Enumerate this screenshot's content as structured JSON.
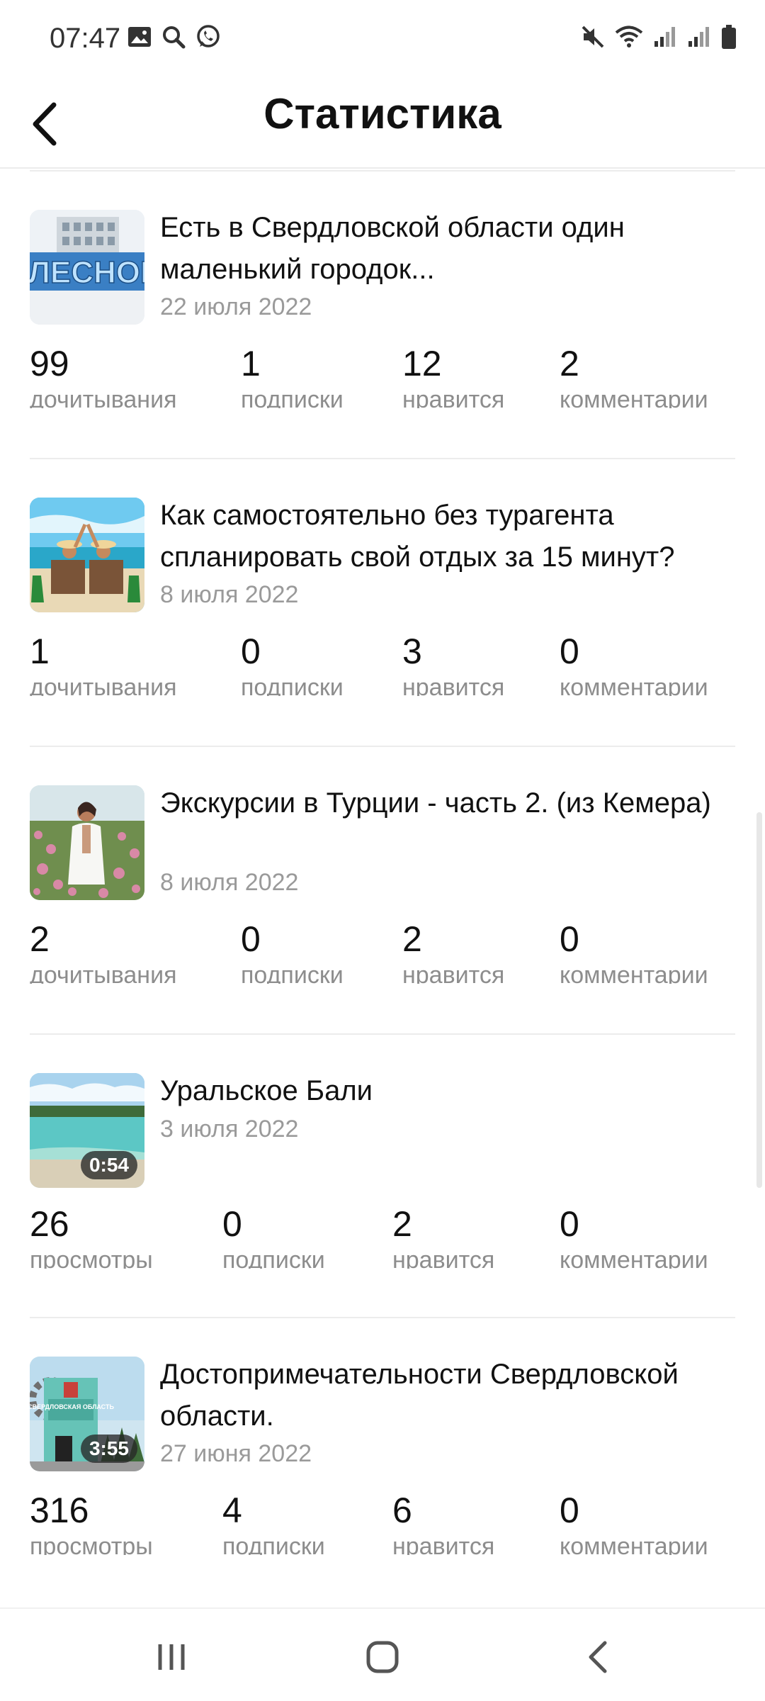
{
  "status_bar": {
    "time": "07:47"
  },
  "header": {
    "title": "Статистика"
  },
  "articles": [
    {
      "title": "Есть в Свердловской области один маленький городок...",
      "date": "22 июля 2022",
      "duration": "",
      "stats": [
        {
          "value": "99",
          "label": "дочитывания"
        },
        {
          "value": "1",
          "label": "подписки"
        },
        {
          "value": "12",
          "label": "нравится"
        },
        {
          "value": "2",
          "label": "комментарии"
        }
      ]
    },
    {
      "title": "Как самостоятельно без турагента спланировать свой отдых за 15 минут?",
      "date": "8 июля 2022",
      "duration": "",
      "stats": [
        {
          "value": "1",
          "label": "дочитывания"
        },
        {
          "value": "0",
          "label": "подписки"
        },
        {
          "value": "3",
          "label": "нравится"
        },
        {
          "value": "0",
          "label": "комментарии"
        }
      ]
    },
    {
      "title": "Экскурсии в Турции - часть 2. (из Кемера)",
      "date": "8 июля 2022",
      "duration": "",
      "stats": [
        {
          "value": "2",
          "label": "дочитывания"
        },
        {
          "value": "0",
          "label": "подписки"
        },
        {
          "value": "2",
          "label": "нравится"
        },
        {
          "value": "0",
          "label": "комментарии"
        }
      ]
    },
    {
      "title": "Уральское Бали",
      "date": "3 июля 2022",
      "duration": "0:54",
      "stats": [
        {
          "value": "26",
          "label": "просмотры"
        },
        {
          "value": "0",
          "label": "подписки"
        },
        {
          "value": "2",
          "label": "нравится"
        },
        {
          "value": "0",
          "label": "комментарии"
        }
      ]
    },
    {
      "title": "Достопримечательности Свердловской области.",
      "date": "27 июня 2022",
      "duration": "3:55",
      "stats": [
        {
          "value": "316",
          "label": "просмотры"
        },
        {
          "value": "4",
          "label": "подписки"
        },
        {
          "value": "6",
          "label": "нравится"
        },
        {
          "value": "0",
          "label": "комментарии"
        }
      ]
    }
  ],
  "thumbnails": [
    "lesnoy-town-photo",
    "beach-chairs-photo",
    "woman-in-flower-field-photo",
    "turquoise-lake-video",
    "sverdlovsk-landmarks-video"
  ],
  "thumb_lettering": {
    "lesnoy": "ЛЕСНОЙ",
    "sverdlovsk": "СВЕРДЛОВСКАЯ ОБЛАСТЬ"
  },
  "colors": {
    "text": "#111111",
    "secondary": "#9a9a9a",
    "divider": "#ececec"
  }
}
